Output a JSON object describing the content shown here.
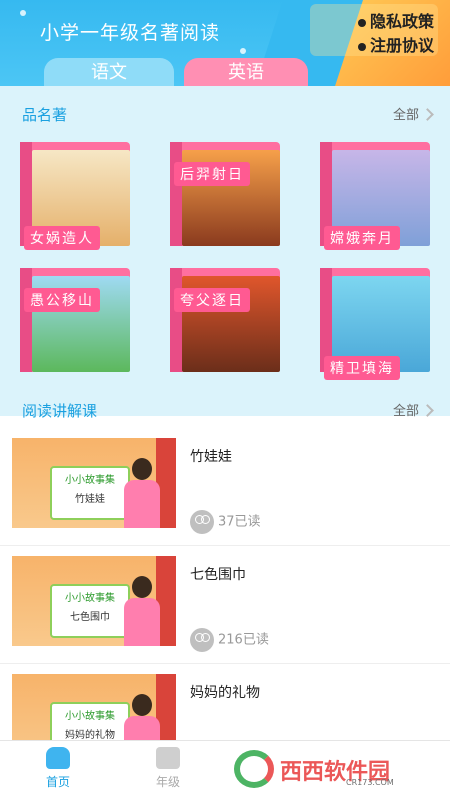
{
  "header": {
    "title": "小学一年级名著阅读",
    "links": [
      "隐私政策",
      "注册协议"
    ],
    "tabs": [
      "语文",
      "英语"
    ]
  },
  "classics": {
    "title": "品名著",
    "more": "全部",
    "books": [
      "女娲造人",
      "后羿射日",
      "嫦娥奔月",
      "愚公移山",
      "夸父逐日",
      "精卫填海"
    ]
  },
  "lessons": {
    "title": "阅读讲解课",
    "more": "全部",
    "courses": [
      {
        "title": "竹娃娃",
        "reads": "37已读",
        "board": "小小故事集",
        "board_sub": "竹娃娃"
      },
      {
        "title": "七色围巾",
        "reads": "216已读",
        "board": "小小故事集",
        "board_sub": "七色围巾"
      },
      {
        "title": "妈妈的礼物",
        "reads": "",
        "board": "小小故事集",
        "board_sub": "妈妈的礼物"
      }
    ]
  },
  "tabbar": {
    "items": [
      "首页",
      "年级"
    ]
  },
  "watermark": {
    "text": "西西软件园",
    "sub": "CR173.COM"
  },
  "colors": {
    "accent": "#1aa0e0",
    "tab_en": "#ff8fb3",
    "section_bg": "#dbf3fb"
  }
}
